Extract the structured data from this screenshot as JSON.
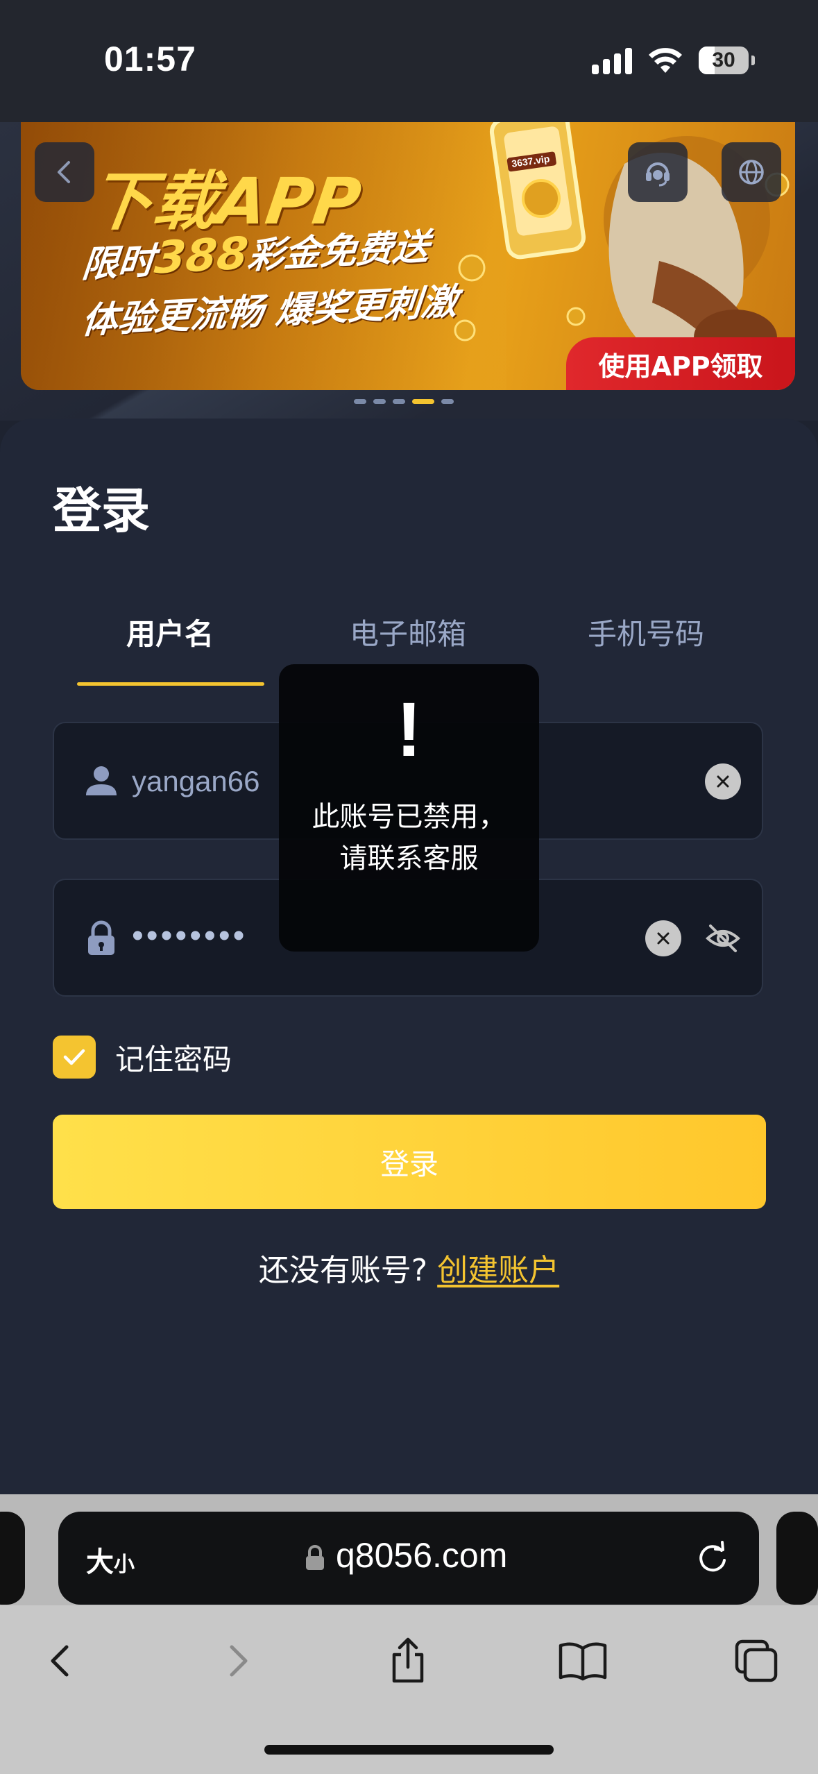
{
  "status_bar": {
    "time": "01:57",
    "battery": "30"
  },
  "banner": {
    "title": "下载APP",
    "line1_prefix": "限时",
    "line1_amount": "388",
    "line1_suffix": "彩金免费送",
    "line2": "体验更流畅 爆奖更刺激",
    "phone_label": "3637.vip",
    "cta": "使用APP领取",
    "slides": 5,
    "active_slide": 4
  },
  "login": {
    "title": "登录",
    "tabs": [
      {
        "label": "用户名",
        "active": true
      },
      {
        "label": "电子邮箱",
        "active": false
      },
      {
        "label": "手机号码",
        "active": false
      }
    ],
    "username": {
      "value": "yangan66"
    },
    "password": {
      "value": "••••••••"
    },
    "remember_label": "记住密码",
    "remember_checked": true,
    "submit_label": "登录",
    "register_prompt": "还没有账号?",
    "register_link": "创建账户"
  },
  "toast": {
    "icon": "!",
    "message": "此账号已禁用，请联系客服"
  },
  "browser": {
    "text_size_big": "大",
    "text_size_small": "小",
    "url": "q8056.com"
  },
  "colors": {
    "accent": "#f4c430",
    "card_bg": "#212737",
    "input_bg": "#151a26",
    "cta_red": "#e0282c"
  }
}
